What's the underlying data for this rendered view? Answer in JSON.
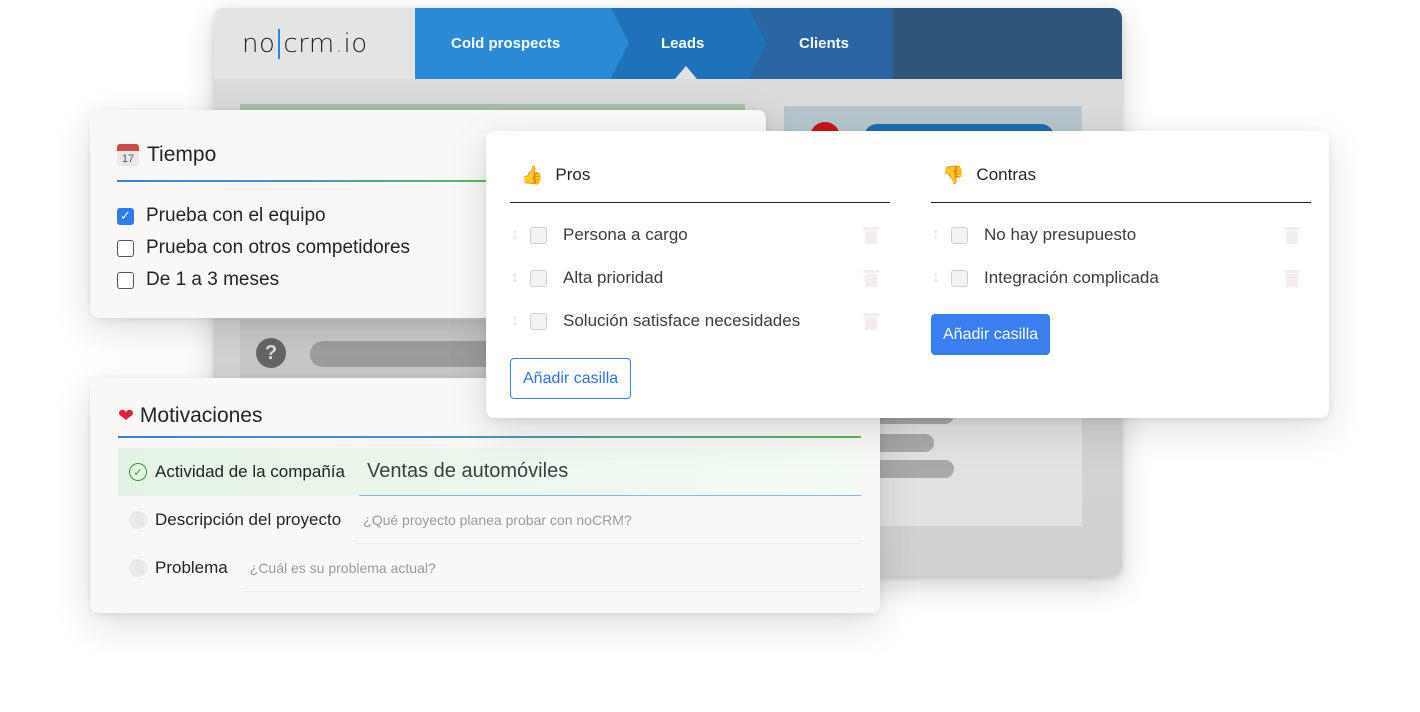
{
  "app": {
    "logo": {
      "left": "no",
      "right": "crm",
      "dot": ".",
      "tld": "io"
    },
    "pipeline": [
      {
        "label": "Cold prospects",
        "color": "#2b8ad6"
      },
      {
        "label": "Leads",
        "color": "#1f72b8",
        "active": true
      },
      {
        "label": "Clients",
        "color": "#2b64a2"
      }
    ],
    "background_question_icon": "?"
  },
  "tiempo": {
    "icon": "calendar-icon",
    "calendar_day": "17",
    "title": "Tiempo",
    "items": [
      {
        "label": "Prueba con el equipo",
        "checked": true,
        "check_glyph": "✓"
      },
      {
        "label": "Prueba con otros competidores",
        "checked": false
      },
      {
        "label": "De 1 a 3 meses",
        "checked": false
      }
    ]
  },
  "motivaciones": {
    "icon": "heart-icon",
    "icon_glyph": "❤",
    "title": "Motivaciones",
    "fields": [
      {
        "label": "Actividad de la compañía",
        "value": "Ventas de automóviles",
        "placeholder": "",
        "done": true,
        "status_glyph": "✓"
      },
      {
        "label": "Descripción del proyecto",
        "value": "",
        "placeholder": "¿Qué proyecto planea probar con noCRM?",
        "done": false
      },
      {
        "label": "Problema",
        "value": "",
        "placeholder": "¿Cuál es su problema actual?",
        "done": false
      }
    ]
  },
  "pros": {
    "icon": "thumbs-up-icon",
    "icon_glyph": "👍",
    "title": "Pros",
    "items": [
      {
        "label": "Persona a cargo",
        "checked": false
      },
      {
        "label": "Alta prioridad",
        "checked": false
      },
      {
        "label": "Solución satisface necesidades",
        "checked": false
      }
    ],
    "add_button": "Añadir casilla"
  },
  "contras": {
    "icon": "thumbs-down-icon",
    "icon_glyph": "👎",
    "title": "Contras",
    "items": [
      {
        "label": "No hay presupuesto",
        "checked": false
      },
      {
        "label": "Integración complicada",
        "checked": false
      }
    ],
    "add_button": "Añadir casilla"
  },
  "glyphs": {
    "drag": "↕"
  },
  "colors": {
    "accent_blue": "#3a7ef2",
    "success_green": "#2f9e44",
    "danger_red": "#c9141b"
  }
}
